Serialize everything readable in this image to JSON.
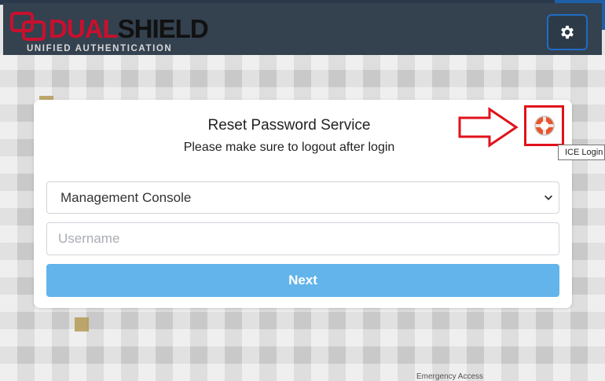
{
  "header": {
    "logo_word_1": "DUAL",
    "logo_word_2": "SHIELD",
    "logo_tagline": "UNIFIED AUTHENTICATION",
    "settings_icon": "gear-icon"
  },
  "card": {
    "title": "Reset Password Service",
    "subtitle": "Please make sure to logout after login",
    "application_select": {
      "selected": "Management Console"
    },
    "username": {
      "placeholder": "Username",
      "value": ""
    },
    "next_label": "Next"
  },
  "ice_login": {
    "icon": "lifebuoy-icon",
    "tooltip": "ICE Login"
  },
  "background": {
    "footer_text": "Emergency Access"
  },
  "colors": {
    "header_bg": "#34414f",
    "brand_red": "#c8102e",
    "button_blue": "#62b4ea",
    "annotation_red": "#e0121b"
  }
}
